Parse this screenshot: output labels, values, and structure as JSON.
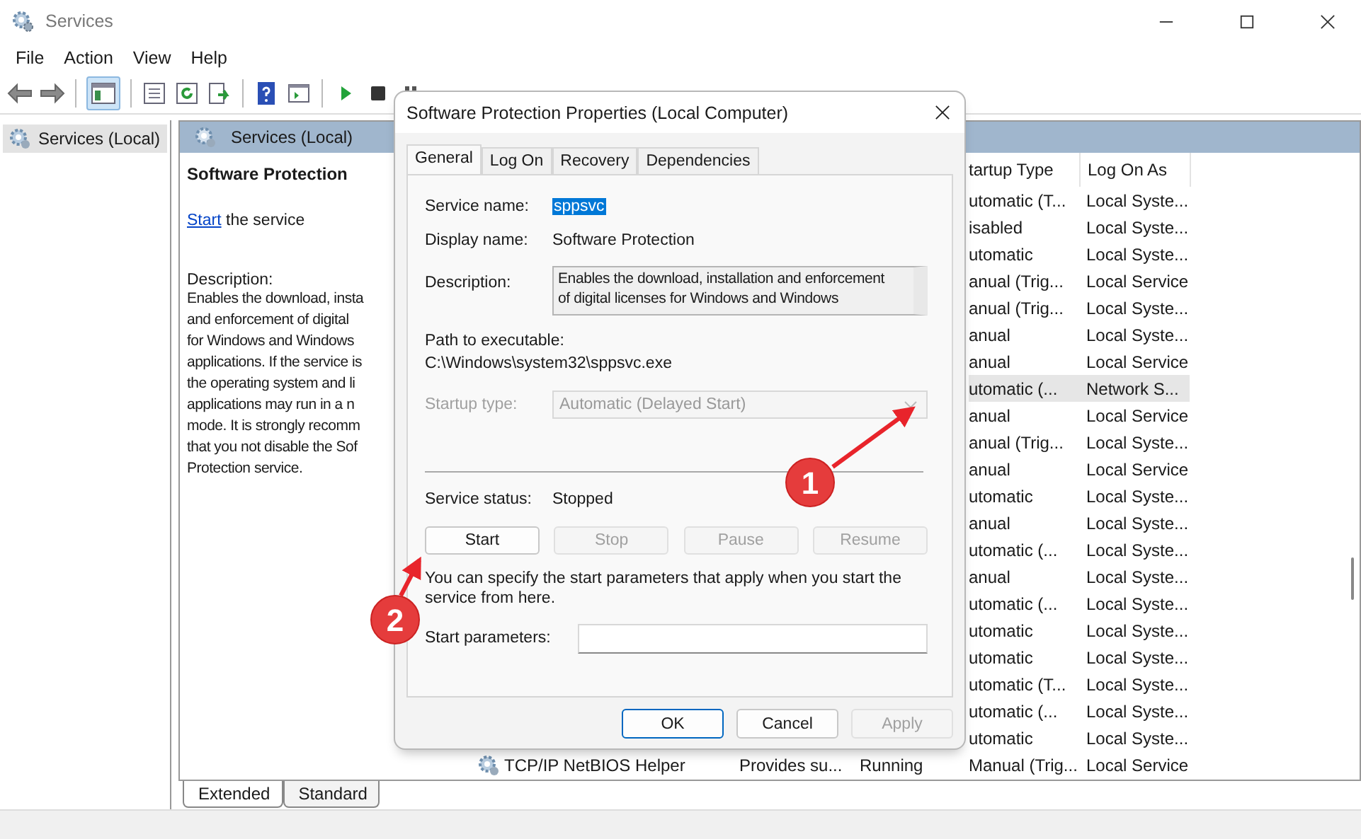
{
  "window": {
    "title": "Services"
  },
  "menu": [
    "File",
    "Action",
    "View",
    "Help"
  ],
  "toolbar": {
    "console_tree_shown": true
  },
  "tree": {
    "items": [
      {
        "label": "Services (Local)",
        "selected": true
      }
    ]
  },
  "pane": {
    "title": "Services (Local)",
    "service_name": "Software Protection",
    "action_link": "Start",
    "action_text": "the service",
    "description_label": "Description:",
    "description_lines": [
      "Enables the download, insta",
      "and enforcement of digital",
      "for Windows and Windows",
      "applications. If the service is",
      "the operating system and li",
      "applications may run in a n",
      "mode. It is strongly recomm",
      "that you not disable the Sof",
      "Protection service."
    ]
  },
  "table": {
    "columns": [
      "tartup Type",
      "Log On As"
    ],
    "rows": [
      {
        "startup_type": "utomatic (T...",
        "log_on_as": "Local Syste...",
        "selected": false
      },
      {
        "startup_type": "isabled",
        "log_on_as": "Local Syste...",
        "selected": false
      },
      {
        "startup_type": "utomatic",
        "log_on_as": "Local Syste...",
        "selected": false
      },
      {
        "startup_type": "anual (Trig...",
        "log_on_as": "Local Service",
        "selected": false
      },
      {
        "startup_type": "anual (Trig...",
        "log_on_as": "Local Syste...",
        "selected": false
      },
      {
        "startup_type": "anual",
        "log_on_as": "Local Syste...",
        "selected": false
      },
      {
        "startup_type": "anual",
        "log_on_as": "Local Service",
        "selected": false
      },
      {
        "startup_type": "utomatic (...",
        "log_on_as": "Network S...",
        "selected": true
      },
      {
        "startup_type": "anual",
        "log_on_as": "Local Service",
        "selected": false
      },
      {
        "startup_type": "anual (Trig...",
        "log_on_as": "Local Syste...",
        "selected": false
      },
      {
        "startup_type": "anual",
        "log_on_as": "Local Service",
        "selected": false
      },
      {
        "startup_type": "utomatic",
        "log_on_as": "Local Syste...",
        "selected": false
      },
      {
        "startup_type": "anual",
        "log_on_as": "Local Syste...",
        "selected": false
      },
      {
        "startup_type": "utomatic (...",
        "log_on_as": "Local Syste...",
        "selected": false
      },
      {
        "startup_type": "anual",
        "log_on_as": "Local Syste...",
        "selected": false
      },
      {
        "startup_type": "utomatic (...",
        "log_on_as": "Local Syste...",
        "selected": false
      },
      {
        "startup_type": "utomatic",
        "log_on_as": "Local Syste...",
        "selected": false
      },
      {
        "startup_type": "utomatic",
        "log_on_as": "Local Syste...",
        "selected": false
      },
      {
        "startup_type": "utomatic (T...",
        "log_on_as": "Local Syste...",
        "selected": false
      },
      {
        "startup_type": "utomatic (...",
        "log_on_as": "Local Syste...",
        "selected": false
      },
      {
        "startup_type": "utomatic",
        "log_on_as": "Local Syste...",
        "selected": false
      },
      {
        "name": "TCP/IP NetBIOS Helper",
        "description": "Provides su...",
        "status": "Running",
        "startup_type": "Manual (Trig...",
        "log_on_as": "Local Service",
        "selected": false
      }
    ]
  },
  "view_tabs": [
    {
      "label": "Extended",
      "selected": true
    },
    {
      "label": "Standard",
      "selected": false
    }
  ],
  "dialog": {
    "title": "Software Protection Properties (Local Computer)",
    "tabs": [
      {
        "label": "General",
        "selected": true
      },
      {
        "label": "Log On",
        "selected": false
      },
      {
        "label": "Recovery",
        "selected": false
      },
      {
        "label": "Dependencies",
        "selected": false
      }
    ],
    "service_name_label": "Service name:",
    "service_name": "sppsvc",
    "service_name_highlighted": true,
    "display_name_label": "Display name:",
    "display_name": "Software Protection",
    "description_label": "Description:",
    "description_lines": [
      "Enables the download, installation and enforcement",
      "of digital licenses for Windows and Windows"
    ],
    "path_label": "Path to executable:",
    "path": "C:\\Windows\\system32\\sppsvc.exe",
    "startup_type_label": "Startup type:",
    "startup_type": "Automatic (Delayed Start)",
    "startup_type_disabled": true,
    "status_label": "Service status:",
    "status": "Stopped",
    "service_buttons": [
      {
        "label": "Start",
        "disabled": false
      },
      {
        "label": "Stop",
        "disabled": true
      },
      {
        "label": "Pause",
        "disabled": true
      },
      {
        "label": "Resume",
        "disabled": true
      }
    ],
    "hint": "You can specify the start parameters that apply when you start the service from here.",
    "parameters_label": "Start parameters:",
    "buttons": [
      {
        "label": "OK",
        "default": true,
        "disabled": false
      },
      {
        "label": "Cancel",
        "default": false,
        "disabled": false
      },
      {
        "label": "Apply",
        "default": false,
        "disabled": true
      }
    ]
  },
  "annotations": [
    {
      "number": "1"
    },
    {
      "number": "2"
    }
  ]
}
